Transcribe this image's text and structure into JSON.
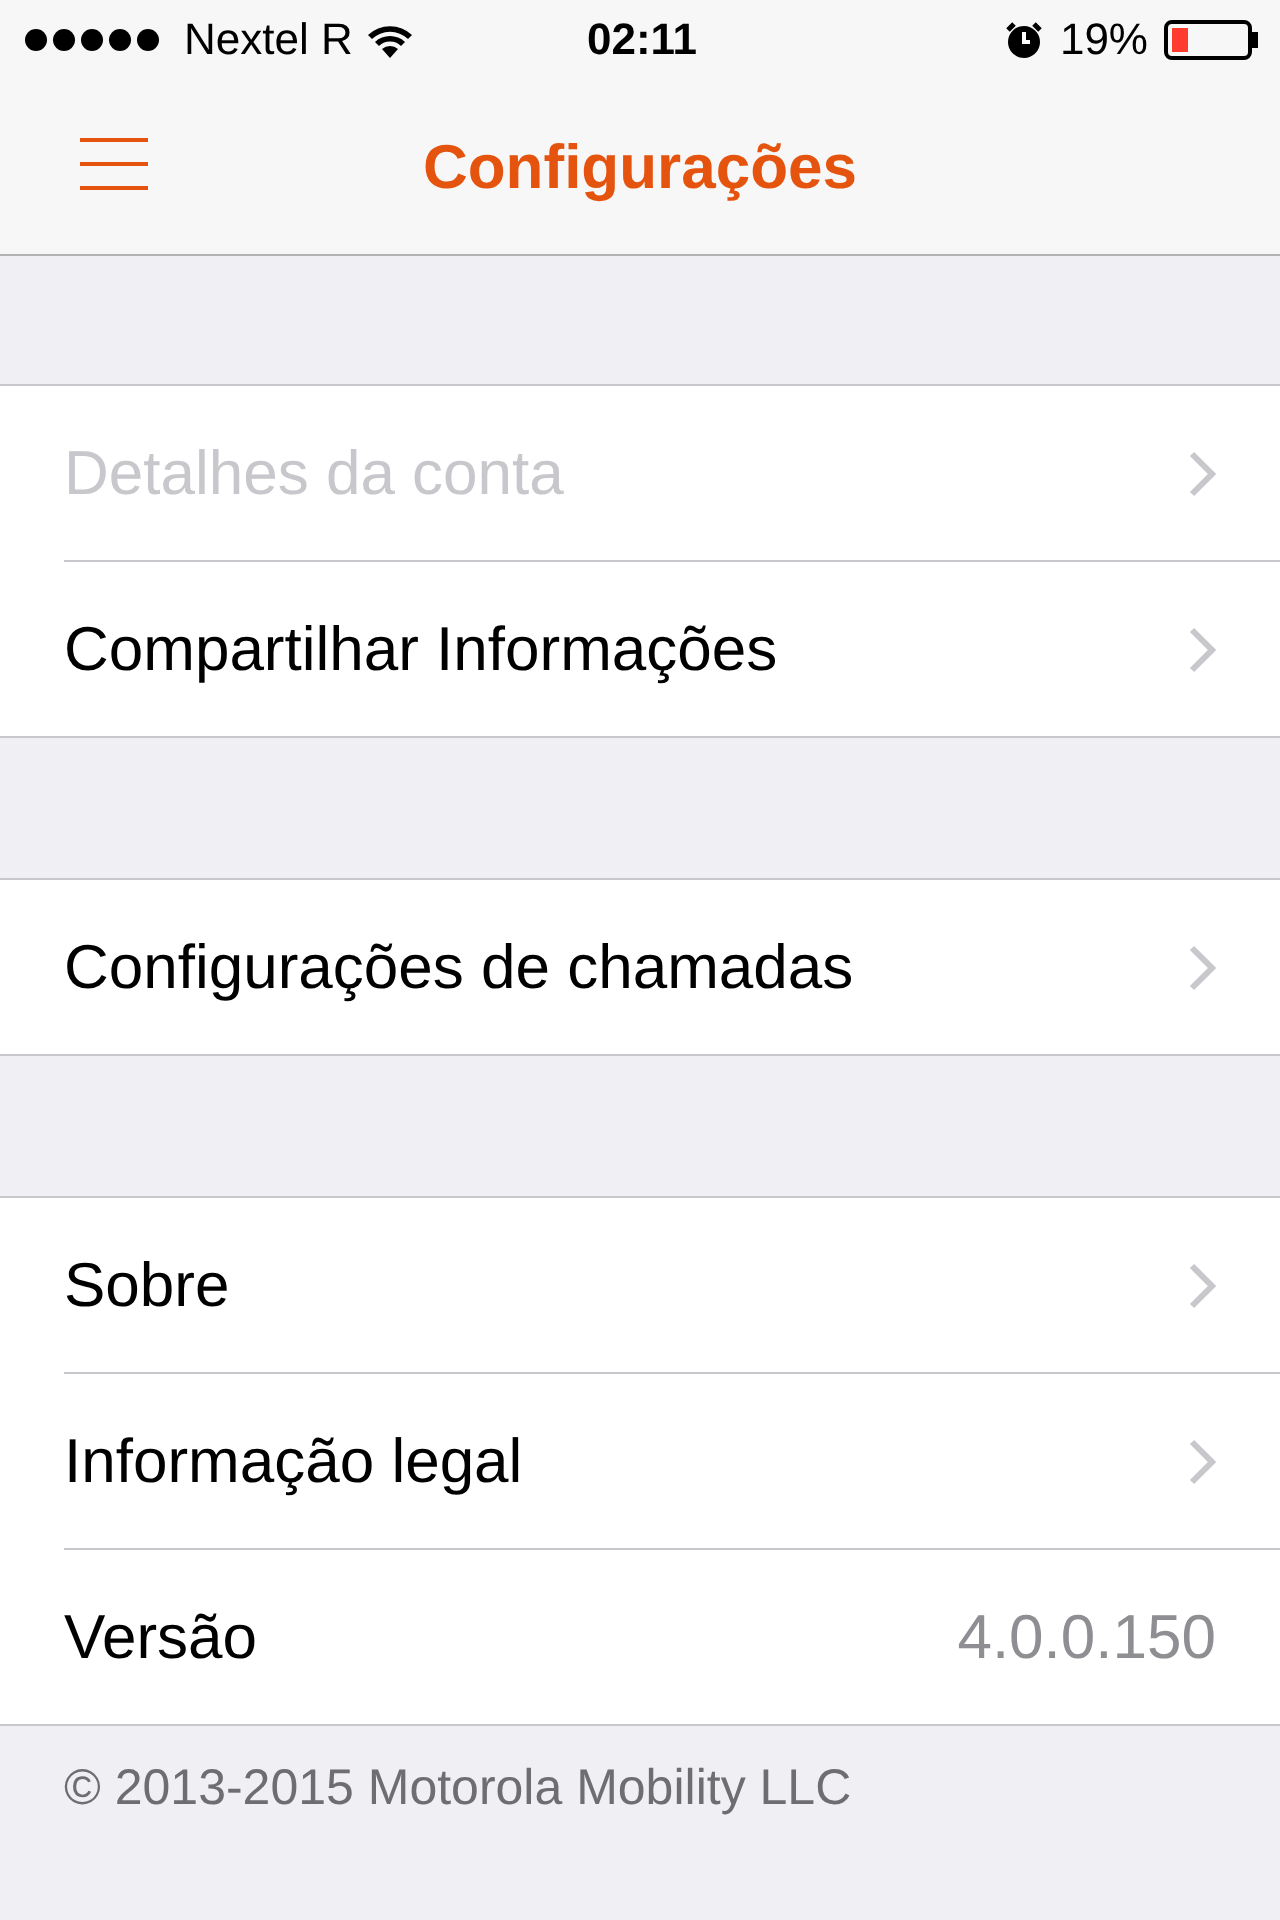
{
  "status_bar": {
    "carrier": "Nextel R",
    "time": "02:11",
    "battery": "19%"
  },
  "nav_bar": {
    "title": "Configurações"
  },
  "groups": [
    {
      "rows": [
        {
          "kind": "link",
          "label": "Detalhes da conta",
          "disabled": true
        },
        {
          "kind": "link",
          "label": "Compartilhar Informações",
          "disabled": false
        }
      ]
    },
    {
      "rows": [
        {
          "kind": "link",
          "label": "Configurações de chamadas",
          "disabled": false
        }
      ]
    },
    {
      "rows": [
        {
          "kind": "link",
          "label": "Sobre",
          "disabled": false
        },
        {
          "kind": "link",
          "label": "Informação legal",
          "disabled": false
        },
        {
          "kind": "value",
          "label": "Versão",
          "value": "4.0.0.150",
          "disabled": false
        }
      ]
    }
  ],
  "footer": "© 2013-2015 Motorola Mobility LLC"
}
